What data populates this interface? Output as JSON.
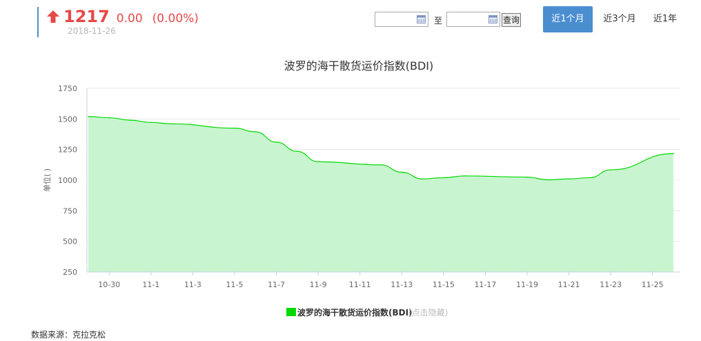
{
  "quote": {
    "price": "1217",
    "change": "0.00",
    "change_pct": "(0.00%)",
    "date": "2018-11-26",
    "direction_icon": "arrow-up-icon",
    "color": "#e64848"
  },
  "controls": {
    "start_date": "",
    "end_date": "",
    "to_label": "至",
    "query_label": "查询",
    "calendar_icon": "calendar-icon",
    "tabs": [
      {
        "label": "近1个月",
        "active": true
      },
      {
        "label": "近3个月",
        "active": false
      },
      {
        "label": "近1年",
        "active": false
      }
    ],
    "accent_color": "#4a8ed0"
  },
  "chart_data": {
    "type": "area",
    "title": "波罗的海干散货运价指数(BDI)",
    "ylabel": "单位( )",
    "xlabel": "",
    "ylim": [
      250,
      1750
    ],
    "yticks": [
      250,
      500,
      750,
      1000,
      1250,
      1500,
      1750
    ],
    "xticks": [
      "10-30",
      "11-1",
      "11-3",
      "11-5",
      "11-7",
      "11-9",
      "11-11",
      "11-13",
      "11-15",
      "11-17",
      "11-19",
      "11-21",
      "11-23",
      "11-25"
    ],
    "x": [
      "10-29",
      "10-30",
      "10-31",
      "11-1",
      "11-2",
      "11-5",
      "11-6",
      "11-7",
      "11-8",
      "11-9",
      "11-12",
      "11-13",
      "11-14",
      "11-15",
      "11-16",
      "11-19",
      "11-20",
      "11-21",
      "11-22",
      "11-23",
      "11-26"
    ],
    "series": [
      {
        "name": "波罗的海干散货运价指数(BDI)",
        "color": "#00d900",
        "fill": "#c8f5cf",
        "values": [
          1520,
          1510,
          1490,
          1472,
          1460,
          1425,
          1395,
          1310,
          1235,
          1150,
          1125,
          1065,
          1010,
          1020,
          1035,
          1025,
          1003,
          1010,
          1020,
          1085,
          1217
        ]
      }
    ],
    "legend": {
      "label": "波罗的海干散货运价指数(BDI)",
      "hint": "(点击隐藏)",
      "position": "bottom"
    },
    "grid": true
  },
  "footer": {
    "source": "数据来源：克拉克松"
  }
}
